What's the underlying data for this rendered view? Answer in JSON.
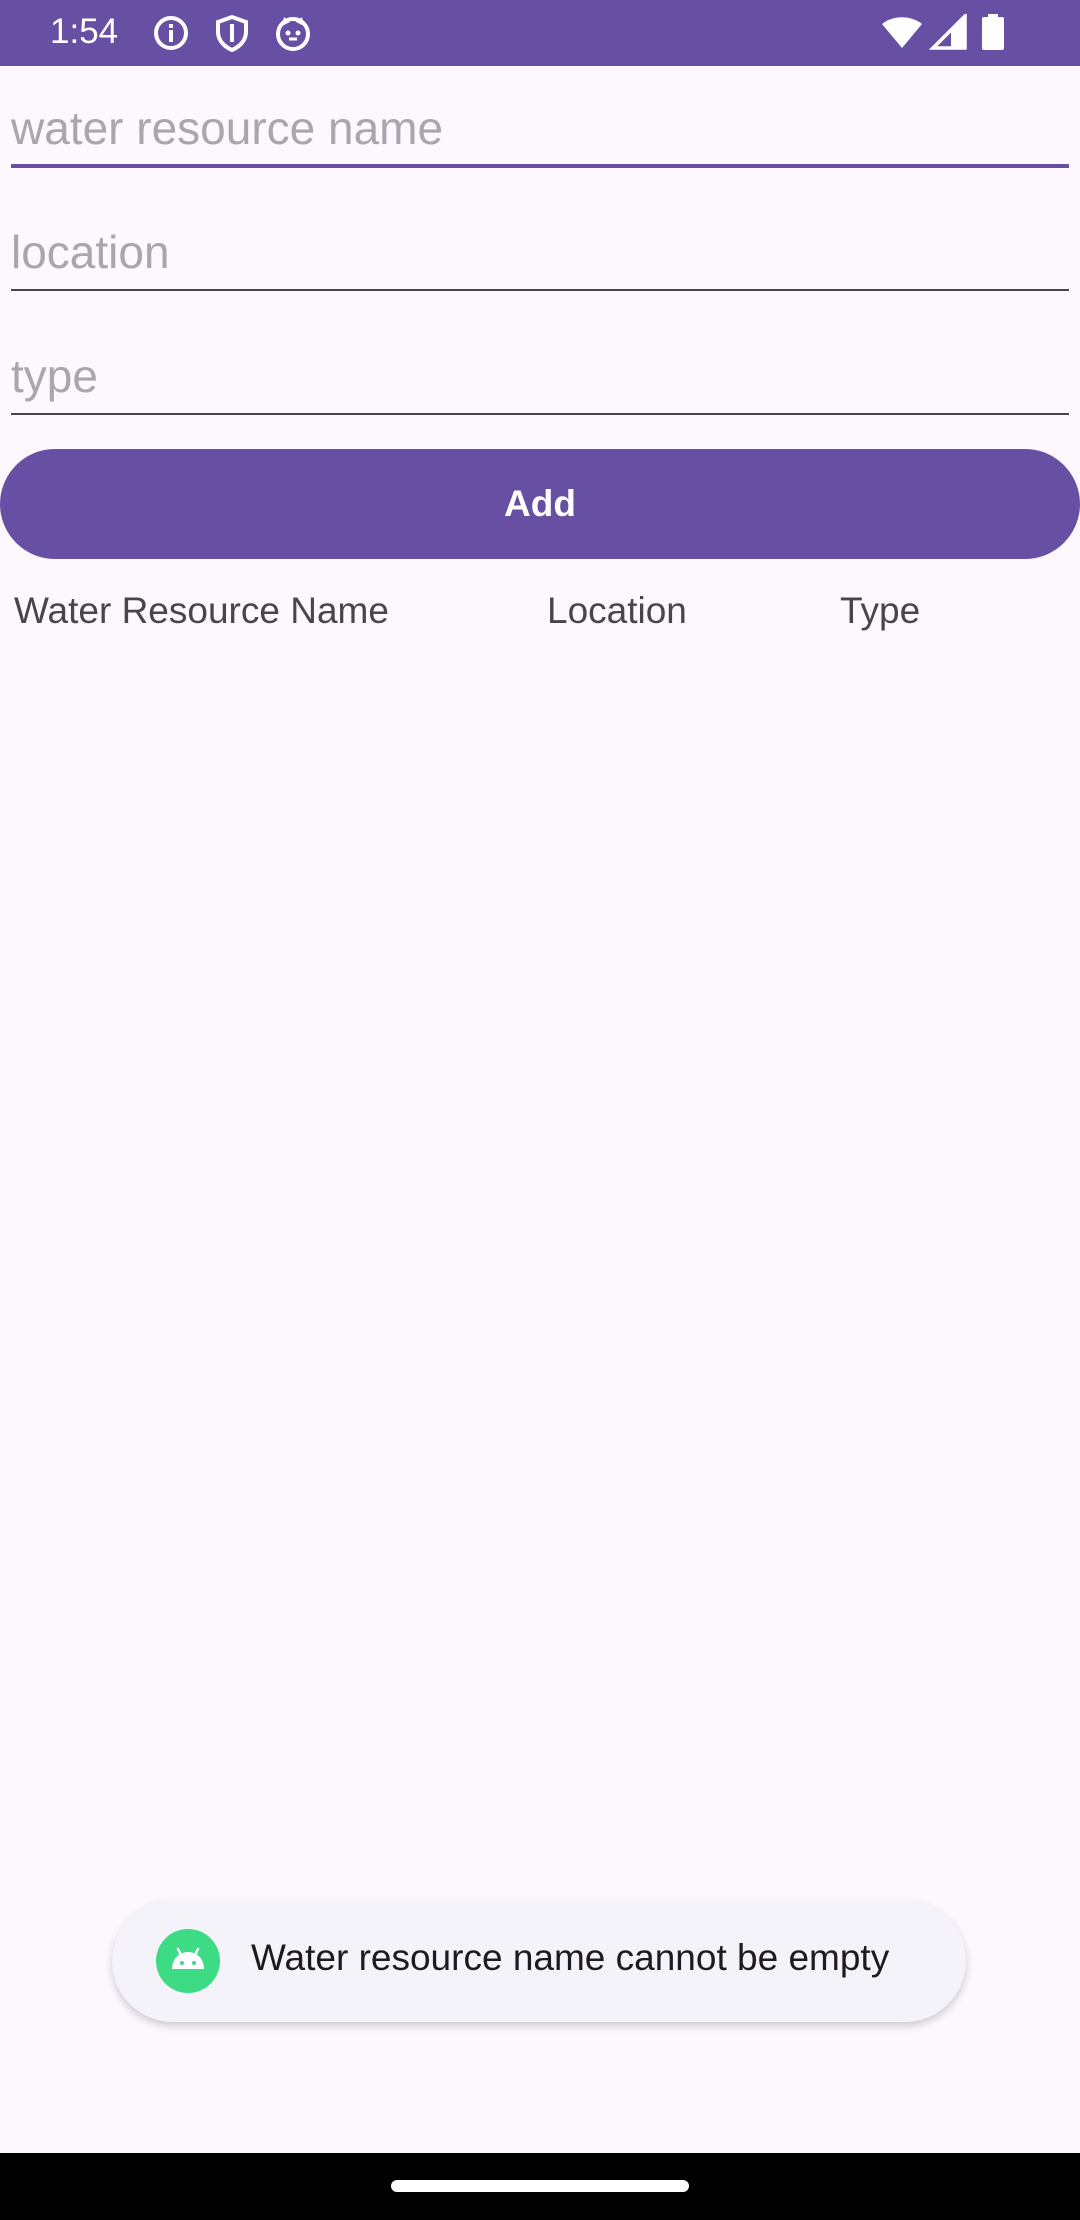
{
  "status_bar": {
    "time": "1:54",
    "left_icons": [
      "info-icon",
      "shield-icon",
      "cat-face-icon"
    ],
    "right_icons": [
      "wifi-icon",
      "signal-icon",
      "battery-icon"
    ]
  },
  "form": {
    "name_placeholder": "water resource name",
    "name_value": "",
    "location_placeholder": "location",
    "location_value": "",
    "type_placeholder": "type",
    "type_value": "",
    "add_label": "Add"
  },
  "table": {
    "headers": [
      "Water Resource Name",
      "Location",
      "Type"
    ],
    "rows": []
  },
  "toast": {
    "icon": "android-icon",
    "message": "Water resource name cannot be empty"
  },
  "colors": {
    "primary": "#6750A4",
    "background": "#FDF7FE",
    "toast_bg": "#F4F3F9",
    "toast_icon": "#3DDC84"
  }
}
